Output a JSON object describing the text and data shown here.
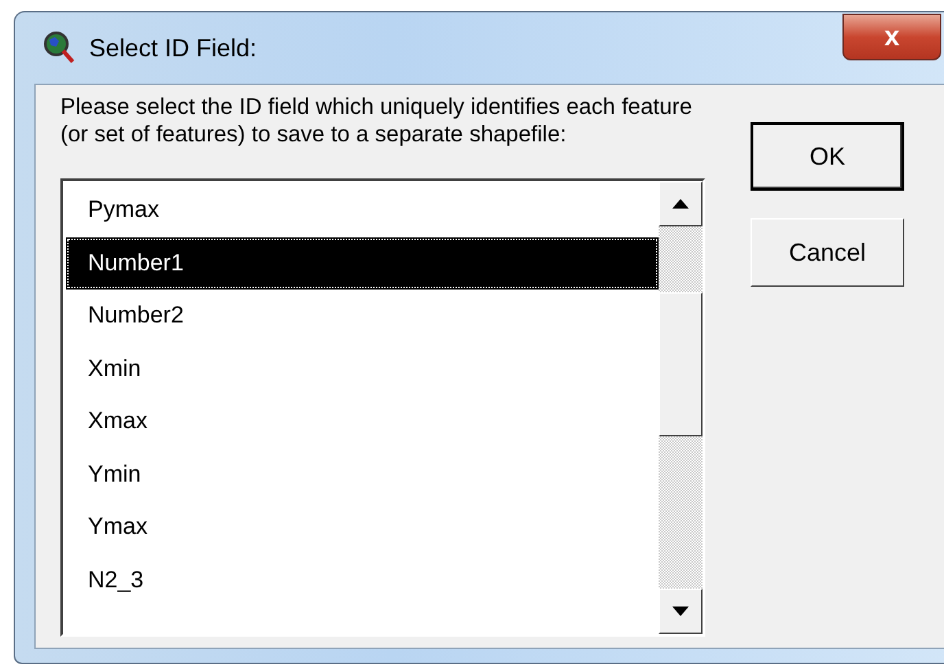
{
  "window": {
    "title": "Select ID Field:",
    "close": "x"
  },
  "prompt": "Please select the ID field which uniquely identifies each feature (or set of features) to save to a separate shapefile:",
  "buttons": [
    {
      "label": "OK",
      "default": true
    },
    {
      "label": "Cancel",
      "default": false
    }
  ],
  "fields": [
    {
      "label": "Pymax",
      "selected": false
    },
    {
      "label": "Number1",
      "selected": true
    },
    {
      "label": "Number2",
      "selected": false
    },
    {
      "label": "Xmin",
      "selected": false
    },
    {
      "label": "Xmax",
      "selected": false
    },
    {
      "label": "Ymin",
      "selected": false
    },
    {
      "label": "Ymax",
      "selected": false
    },
    {
      "label": "N2_3",
      "selected": false
    }
  ]
}
